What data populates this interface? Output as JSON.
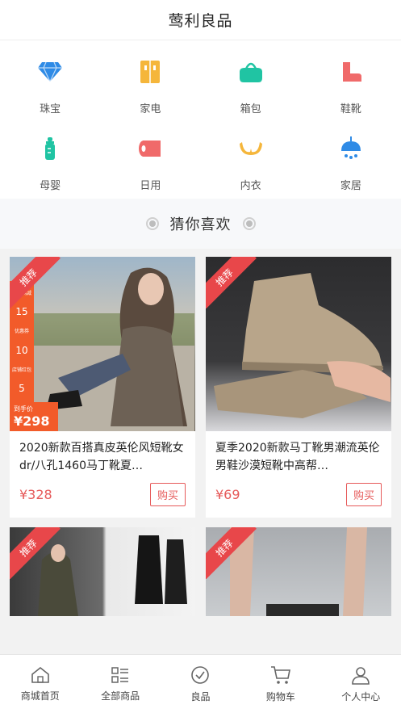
{
  "header": {
    "title": "莺利良品"
  },
  "categories": [
    {
      "label": "珠宝",
      "icon": "diamond-icon",
      "color": "#2f8be6"
    },
    {
      "label": "家电",
      "icon": "appliance-icon",
      "color": "#f5b63b"
    },
    {
      "label": "箱包",
      "icon": "bag-icon",
      "color": "#20c4a3"
    },
    {
      "label": "鞋靴",
      "icon": "boot-icon",
      "color": "#f06a6a"
    },
    {
      "label": "母婴",
      "icon": "baby-bottle-icon",
      "color": "#20c4a3"
    },
    {
      "label": "日用",
      "icon": "tissue-roll-icon",
      "color": "#f06a6a"
    },
    {
      "label": "内衣",
      "icon": "bra-icon",
      "color": "#f5b63b"
    },
    {
      "label": "家居",
      "icon": "lamp-icon",
      "color": "#2f8be6"
    }
  ],
  "section": {
    "title": "猜你喜欢"
  },
  "products": [
    {
      "badge": "推荐",
      "name": "2020新款百搭真皮英伦风短靴女dr/八孔1460马丁靴夏…",
      "price": "¥328",
      "buy": "购买",
      "promo": {
        "lines": [
          "跨店满减",
          "15",
          "优惠券",
          "10",
          "店铺红包",
          "5"
        ],
        "hand_price_label": "到手价",
        "hand_price": "¥298"
      }
    },
    {
      "badge": "推荐",
      "name": "夏季2020新款马丁靴男潮流英伦男鞋沙漠短靴中高帮…",
      "price": "¥69",
      "buy": "购买"
    },
    {
      "badge": "推荐"
    },
    {
      "badge": "推荐"
    }
  ],
  "tabbar": [
    {
      "label": "商城首页",
      "icon": "home-icon"
    },
    {
      "label": "全部商品",
      "icon": "list-icon"
    },
    {
      "label": "良品",
      "icon": "check-circle-icon"
    },
    {
      "label": "购物车",
      "icon": "cart-icon"
    },
    {
      "label": "个人中心",
      "icon": "user-icon"
    }
  ]
}
